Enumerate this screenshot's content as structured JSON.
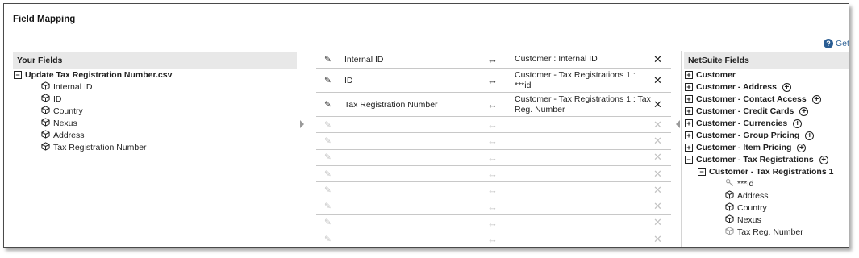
{
  "title": "Field Mapping",
  "help_label": "Get",
  "left_panel": {
    "header": "Your Fields",
    "file_name": "Update Tax Registration Number.csv",
    "fields": [
      "Internal ID",
      "ID",
      "Country",
      "Nexus",
      "Address",
      "Tax Registration Number"
    ]
  },
  "mappings": [
    {
      "source": "Internal ID",
      "target": "Customer : Internal ID"
    },
    {
      "source": "ID",
      "target": "Customer - Tax Registrations 1 : ***id"
    },
    {
      "source": "Tax Registration Number",
      "target": "Customer - Tax Registrations 1 : Tax Reg. Number"
    }
  ],
  "empty_rows": 8,
  "symbols": {
    "pencil": "✎",
    "arrow": "↔",
    "remove": "✕"
  },
  "right_panel": {
    "header": "NetSuite Fields",
    "groups": [
      {
        "label": "Customer",
        "expanded": false,
        "addable": false
      },
      {
        "label": "Customer - Address",
        "expanded": false,
        "addable": true
      },
      {
        "label": "Customer - Contact Access",
        "expanded": false,
        "addable": true
      },
      {
        "label": "Customer - Credit Cards",
        "expanded": false,
        "addable": true
      },
      {
        "label": "Customer - Currencies",
        "expanded": false,
        "addable": true
      },
      {
        "label": "Customer - Group Pricing",
        "expanded": false,
        "addable": true
      },
      {
        "label": "Customer - Item Pricing",
        "expanded": false,
        "addable": true
      },
      {
        "label": "Customer - Tax Registrations",
        "expanded": true,
        "addable": true
      }
    ],
    "subgroup": "Customer - Tax Registrations 1",
    "subfields": [
      {
        "label": "***id",
        "icon": "key-icon",
        "mapped": true
      },
      {
        "label": "Address",
        "icon": "cube-icon",
        "mapped": false
      },
      {
        "label": "Country",
        "icon": "cube-icon",
        "mapped": false
      },
      {
        "label": "Nexus",
        "icon": "cube-icon",
        "mapped": false
      },
      {
        "label": "Tax Reg. Number",
        "icon": "cube-icon",
        "mapped": true
      }
    ]
  }
}
